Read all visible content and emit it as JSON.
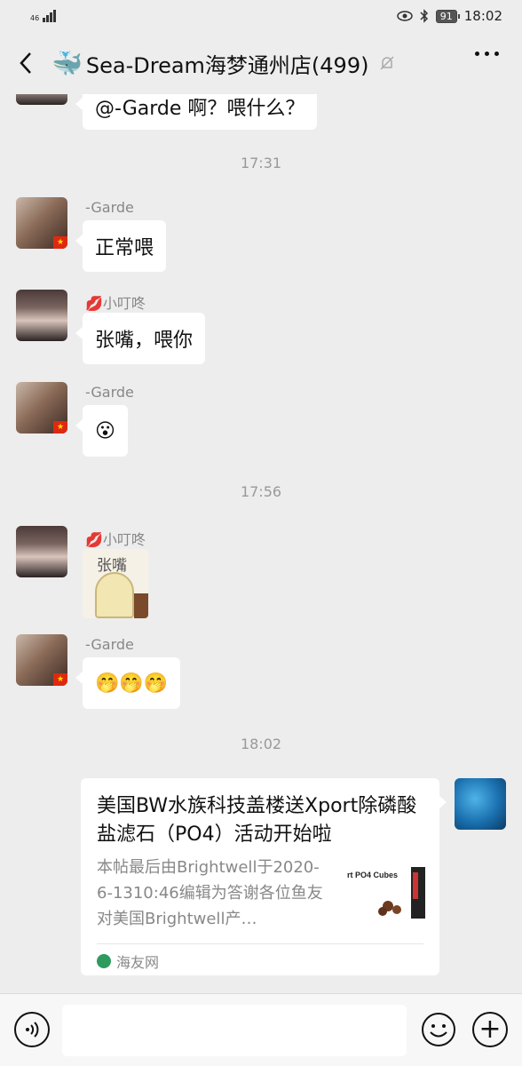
{
  "status_bar": {
    "network": "46",
    "signal_icon": "signal-icon",
    "eye_icon": "eye-icon",
    "bluetooth_icon": "bluetooth-icon",
    "battery": "91",
    "time": "18:02"
  },
  "header": {
    "title": "Sea-Dream海梦通州店(499)",
    "emoji": "🐳",
    "mute_icon": "bell-off-icon",
    "more_icon": "more-icon",
    "back_icon": "back-arrow-icon"
  },
  "messages": [
    {
      "type": "text",
      "sender": "-Garde",
      "text": "@-Garde 啊？喂什么？"
    },
    {
      "type": "time",
      "text": "17:31"
    },
    {
      "type": "text",
      "sender": "-Garde",
      "text": "正常喂"
    },
    {
      "type": "text",
      "sender": "小叮咚",
      "sender_emoji": "💋",
      "text": "张嘴，喂你"
    },
    {
      "type": "text",
      "sender": "-Garde",
      "text": "😮"
    },
    {
      "type": "time",
      "text": "17:56"
    },
    {
      "type": "sticker",
      "sender": "小叮咚",
      "sender_emoji": "💋",
      "caption": "张嘴"
    },
    {
      "type": "text",
      "sender": "-Garde",
      "text": "🤭🤭🤭"
    },
    {
      "type": "time",
      "text": "18:02"
    },
    {
      "type": "link",
      "title": "美国BW水族科技盖楼送Xport除磷酸盐滤石（PO4）活动开始啦",
      "description": "本帖最后由Brightwell于2020-6-1310:46编辑为答谢各位鱼友对美国Brightwell产…",
      "thumb_text": "rt PO4 Cubes",
      "source": "海友网"
    }
  ],
  "input_bar": {
    "voice_icon": "voice-icon",
    "emoji_icon": "emoji-icon",
    "plus_icon": "plus-icon"
  },
  "colors": {
    "background": "#ededed",
    "bubble": "#ffffff",
    "time": "#999999"
  }
}
